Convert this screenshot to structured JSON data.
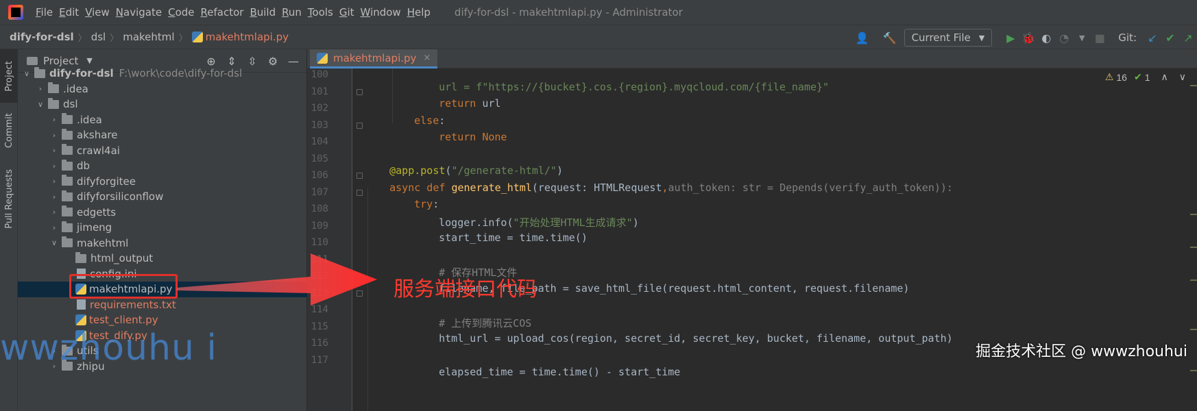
{
  "menubar": {
    "items": [
      "File",
      "Edit",
      "View",
      "Navigate",
      "Code",
      "Refactor",
      "Build",
      "Run",
      "Tools",
      "Git",
      "Window",
      "Help"
    ],
    "window_title": "dify-for-dsl - makehtmlapi.py - Administrator"
  },
  "navbar": {
    "breadcrumbs": [
      "dify-for-dsl",
      "dsl",
      "makehtml",
      "makehtmlapi.py"
    ],
    "run_config": "Current File",
    "git_label": "Git:"
  },
  "tool_strip": {
    "project": "Project",
    "commit": "Commit",
    "pull_requests": "Pull Requests"
  },
  "project_panel": {
    "title": "Project",
    "tree": [
      {
        "name": "dify-for-dsl",
        "path": "F:\\work\\code\\dify-for-dsl",
        "type": "folder",
        "expanded": true
      },
      {
        "name": ".idea",
        "type": "folder",
        "expanded": false
      },
      {
        "name": "dsl",
        "type": "folder",
        "expanded": true
      },
      {
        "name": ".idea",
        "type": "folder",
        "expanded": false
      },
      {
        "name": "akshare",
        "type": "folder",
        "expanded": false
      },
      {
        "name": "crawl4ai",
        "type": "folder",
        "expanded": false
      },
      {
        "name": "db",
        "type": "folder",
        "expanded": false
      },
      {
        "name": "difyforgitee",
        "type": "folder",
        "expanded": false
      },
      {
        "name": "difyforsiliconflow",
        "type": "folder",
        "expanded": false
      },
      {
        "name": "edgetts",
        "type": "folder",
        "expanded": false
      },
      {
        "name": "jimeng",
        "type": "folder",
        "expanded": false
      },
      {
        "name": "makehtml",
        "type": "folder",
        "expanded": true
      },
      {
        "name": "html_output",
        "type": "folder"
      },
      {
        "name": "config.ini",
        "type": "ini"
      },
      {
        "name": "makehtmlapi.py",
        "type": "py",
        "selected": true
      },
      {
        "name": "requirements.txt",
        "type": "txt"
      },
      {
        "name": "test_client.py",
        "type": "py"
      },
      {
        "name": "test_dify.py",
        "type": "py"
      },
      {
        "name": "utils",
        "type": "folder",
        "expanded": false
      },
      {
        "name": "zhipu",
        "type": "folder",
        "expanded": false
      }
    ]
  },
  "editor": {
    "tab": "makehtmlapi.py",
    "inspections": {
      "warnings": "16",
      "ok": "1"
    },
    "line_numbers": [
      "100",
      "101",
      "102",
      "103",
      "104",
      "105",
      "106",
      "107",
      "108",
      "109",
      "110",
      "111",
      "112",
      "113",
      "114",
      "115",
      "116",
      "117"
    ],
    "code": {
      "l100_a": "url = f\"https://{bucket}.cos.{region}.myqcloud.com/{file_name}\"",
      "l101_kw": "return",
      "l101_rest": " url",
      "l102_kw": "else",
      "l102_rest": ":",
      "l103_kw": "return",
      "l103_rest": " None",
      "l105_dec": "@app.post",
      "l105_p1": "(",
      "l105_str": "\"/generate-html/\"",
      "l105_p2": ")",
      "l106_kw": "async def ",
      "l106_fn": "generate_html",
      "l106_a": "(request: HTMLRequest",
      "l106_b": ",",
      "l106_c": "auth_token: str = Depends(verify_auth_token)):",
      "l107_kw": "try",
      "l107_rest": ":",
      "l108_a": "logger.info(",
      "l108_str": "\"开始处理HTML生成请求\"",
      "l108_b": ")",
      "l109": "start_time = time.time()",
      "l111_cmt": "# 保存HTML文件",
      "l112": "filename, file_path = save_html_file(request.html_content, request.filename)",
      "l114_cmt": "# 上传到腾讯云COS",
      "l115": "html_url = upload_cos(region, secret_id, secret_key, bucket, filename, output_path)",
      "l117": "elapsed_time = time.time() - start_time"
    }
  },
  "overlay": {
    "annotation": "服务端接口代码",
    "watermark_left": "wwzhouhu i",
    "watermark_right": "掘金技术社区 @ wwwzhouhui"
  },
  "colors": {
    "accent": "#4a88c7",
    "annotation_red": "#ff3b30",
    "modified_file": "#e27e64"
  }
}
